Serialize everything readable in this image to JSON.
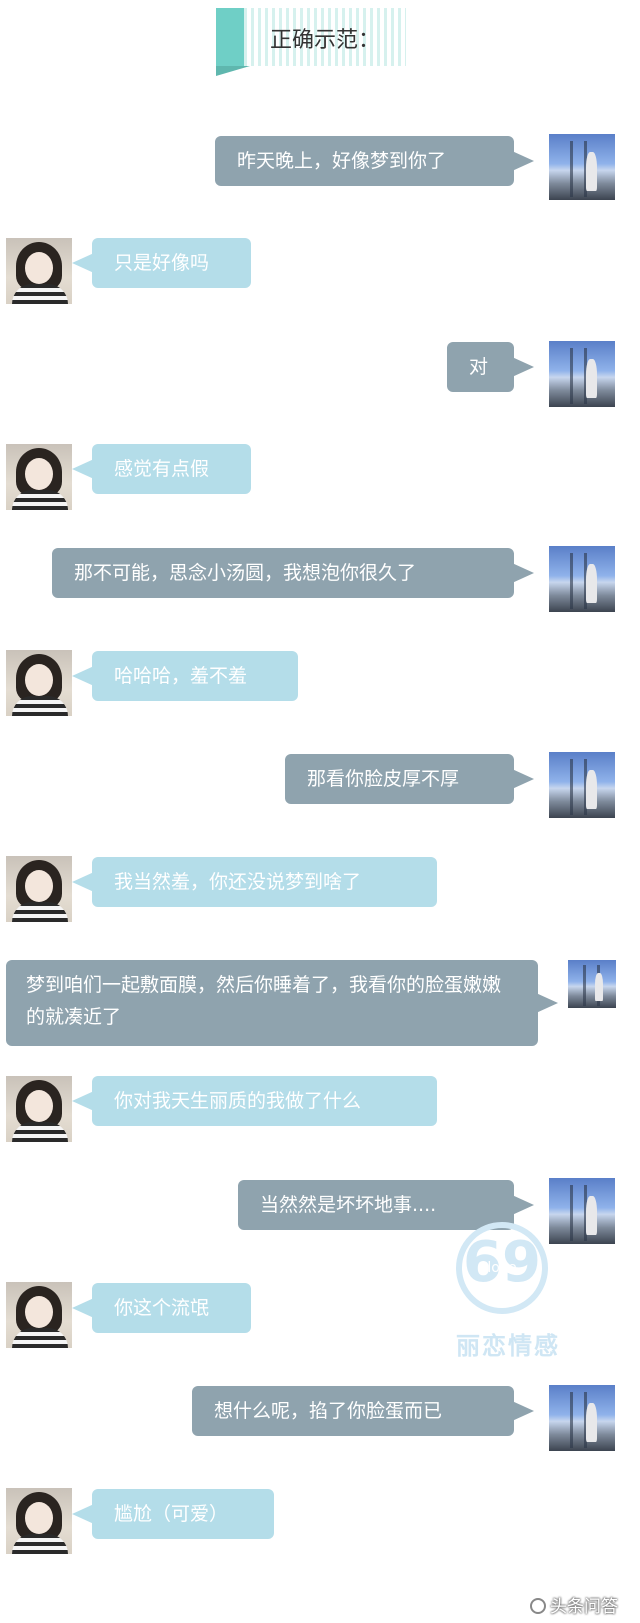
{
  "header": {
    "title": "正确示范："
  },
  "messages": [
    {
      "from": "me",
      "text": "昨天晚上，好像梦到你了"
    },
    {
      "from": "her",
      "text": "只是好像吗"
    },
    {
      "from": "me",
      "text": "对"
    },
    {
      "from": "her",
      "text": "感觉有点假"
    },
    {
      "from": "me",
      "text": "那不可能，思念小汤圆，我想泡你很久了"
    },
    {
      "from": "her",
      "text": "哈哈哈，羞不羞"
    },
    {
      "from": "me",
      "text": "那看你脸皮厚不厚"
    },
    {
      "from": "her",
      "text": "我当然羞，你还没说梦到啥了"
    },
    {
      "from": "me",
      "text": "梦到咱们一起敷面膜，然后你睡着了，我看你的脸蛋嫩嫩的就凑近了"
    },
    {
      "from": "her",
      "text": "你对我天生丽质的我做了什么"
    },
    {
      "from": "me",
      "text": "当然然是坏坏地事...."
    },
    {
      "from": "her",
      "text": "你这个流氓"
    },
    {
      "from": "me",
      "text": "想什么呢，掐了你脸蛋而已"
    },
    {
      "from": "her",
      "text": "尴尬（可爱）"
    }
  ],
  "watermark": {
    "number": "69",
    "love": "love",
    "brand": "丽恋情感"
  },
  "footer": {
    "source": "头条问答"
  },
  "colors": {
    "me_bubble": "#8fa3ae",
    "her_bubble": "#b4dde9",
    "header_tag": "#6fcfc6"
  }
}
